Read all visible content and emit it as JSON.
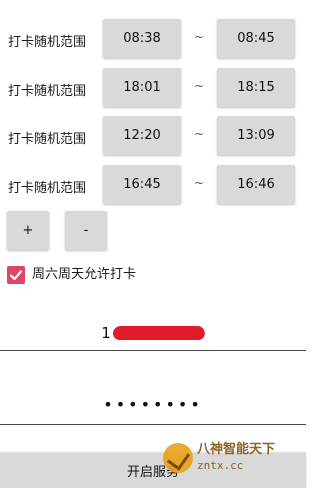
{
  "schedule_rows": [
    {
      "label": "打卡随机范围",
      "start": "08:38",
      "separator": "~",
      "end": "08:45"
    },
    {
      "label": "打卡随机范围",
      "start": "18:01",
      "separator": "~",
      "end": "18:15"
    },
    {
      "label": "打卡随机范围",
      "start": "12:20",
      "separator": "~",
      "end": "13:09"
    },
    {
      "label": "打卡随机范围",
      "start": "16:45",
      "separator": "~",
      "end": "16:46"
    }
  ],
  "controls": {
    "add_label": "+",
    "remove_label": "-"
  },
  "weekend": {
    "label": "周六周天允许打卡",
    "checked": true
  },
  "account": {
    "visible_prefix": "1"
  },
  "password": {
    "masked": "••••••••"
  },
  "start_button": {
    "label": "开启服务"
  },
  "watermark": {
    "title": "八神智能天下",
    "url": "zntx.cc"
  },
  "colors": {
    "accent": "#e0446b",
    "button_bg": "#d9d9d9",
    "redaction": "#e21b2a"
  }
}
